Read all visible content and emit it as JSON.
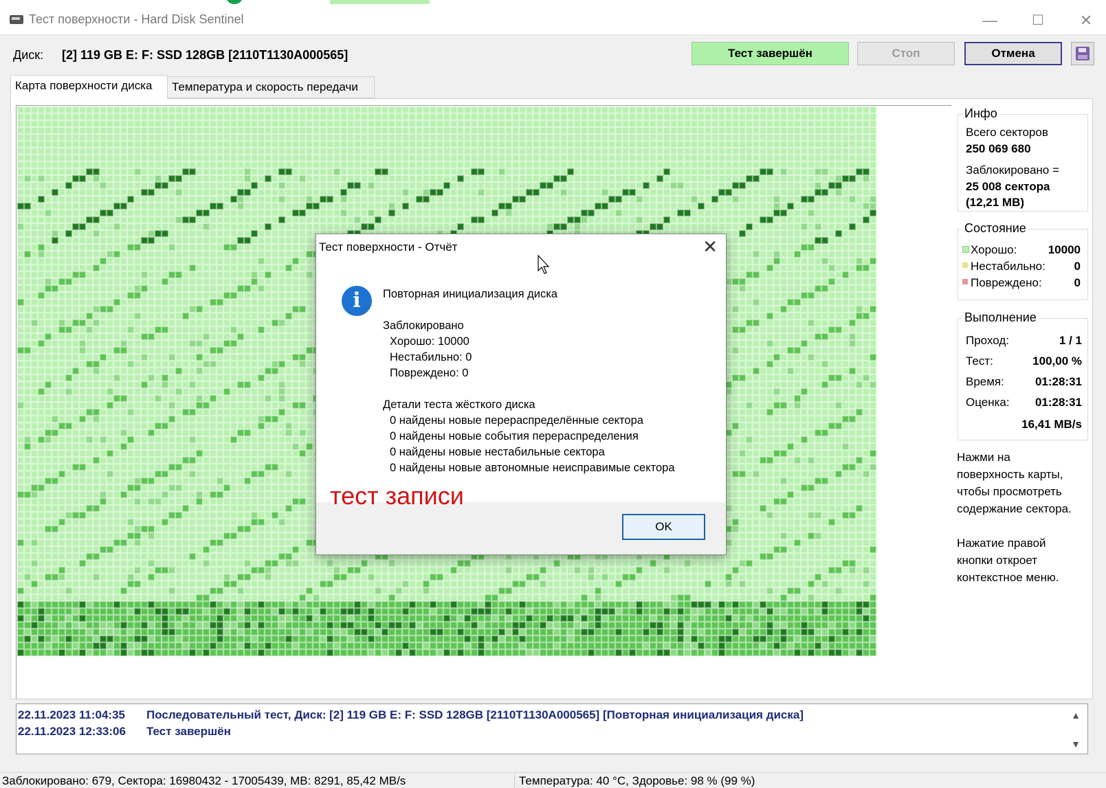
{
  "window": {
    "title": "Тест поверхности - Hard Disk Sentinel",
    "minimize": "—",
    "maximize": "☐",
    "close": "✕"
  },
  "toolbar": {
    "disk_label": "Диск:",
    "disk_name": "[2] 119 GB E: F: SSD 128GB [2110T1130A000565]",
    "done_label": "Тест завершён",
    "stop_label": "Стоп",
    "cancel_label": "Отмена"
  },
  "tabs": [
    {
      "label": "Карта поверхности диска"
    },
    {
      "label": "Температура и скорость передачи"
    }
  ],
  "colors": {
    "good_light": "#b9f0b1",
    "good_mid": "#5cc452",
    "good_dark": "#1e7a1e",
    "unstable": "#f0e08a",
    "damaged": "#e89898"
  },
  "info": {
    "title": "Инфо",
    "total_label": "Всего секторов",
    "total_value": "250 069 680",
    "blocked_label": "Заблокировано =",
    "blocked_value": "25 008 сектора",
    "blocked_mb": "(12,21 MB)"
  },
  "state": {
    "title": "Состояние",
    "rows": [
      {
        "label": "Хорошо:",
        "value": "10000"
      },
      {
        "label": "Нестабильно:",
        "value": "0"
      },
      {
        "label": "Повреждено:",
        "value": "0"
      }
    ]
  },
  "progress": {
    "title": "Выполнение",
    "rows": [
      {
        "label": "Проход:",
        "value": "1 / 1"
      },
      {
        "label": "Тест:",
        "value": "100,00 %"
      },
      {
        "label": "Время:",
        "value": "01:28:31"
      },
      {
        "label": "Оценка:",
        "value": "01:28:31"
      }
    ],
    "speed": "16,41 MB/s"
  },
  "hints": {
    "line1": "Нажми на",
    "line2": "поверхность карты,",
    "line3": "чтобы просмотреть",
    "line4": "содержание сектора.",
    "line5": "Нажатие правой",
    "line6": "кнопки откроет",
    "line7": "контекстное меню."
  },
  "log": [
    {
      "time": "22.11.2023  11:04:35",
      "text": "Последовательный тест, Диск: [2] 119 GB E: F: SSD 128GB [2110T1130A000565] [Повторная инициализация диска]"
    },
    {
      "time": "22.11.2023  12:33:06",
      "text": "Тест завершён"
    }
  ],
  "status": {
    "left": "Заблокировано: 679, Сектора: 16980432 - 17005439, MB: 8291, 85,42 MB/s",
    "right": "Температура: 40  °C,  Здоровье: 98 % (99 %)"
  },
  "dialog": {
    "title": "Тест поверхности - Отчёт",
    "close": "✕",
    "icon": "i",
    "heading": "Повторная инициализация диска",
    "blocked_title": "Заблокировано",
    "good": "Хорошо: 10000",
    "unstable": "Нестабильно: 0",
    "damaged": "Повреждено: 0",
    "details_title": "Детали теста жёсткого диска",
    "d1": "0 найдены новые перераспределённые сектора",
    "d2": "0 найдены новые события перераспределения",
    "d3": "0 найдены новые нестабильные сектора",
    "d4": "0 найдены новые автономные неисправимые сектора",
    "annotation": "тест записи",
    "ok_label": "OK"
  }
}
